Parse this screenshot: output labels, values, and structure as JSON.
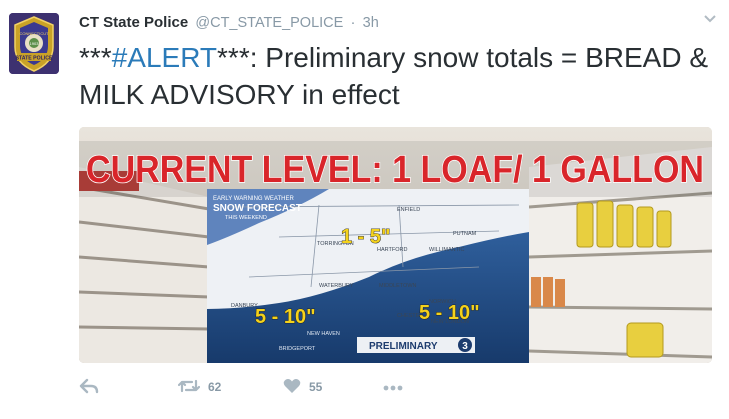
{
  "colors": {
    "accent": "#2b7bb9",
    "meta": "#8899a6",
    "text": "#292f33",
    "icon": "#aab8c2"
  },
  "tweet": {
    "avatar": {
      "icon": "ct-state-police-badge",
      "badge_text_top": "CONNECTICUT",
      "badge_year": "1903",
      "badge_text_bottom": "STATE POLICE"
    },
    "author_name": "CT State Police",
    "handle": "@CT_STATE_POLICE",
    "separator": "·",
    "timestamp": "3h",
    "text_prefix": "***",
    "hashtag": "#ALERT",
    "text_rest": "***: Preliminary snow totals = BREAD & MILK ADVISORY in effect",
    "media": {
      "banner": "CURRENT LEVEL: 1 LOAF/ 1 GALLON",
      "inset_header": "EARLY WARNING WEATHER",
      "inset_title": "SNOW FORECAST",
      "inset_subtitle": "THIS WEEKEND",
      "amount_north": "1 - 5\"",
      "amount_southwest": "5 - 10\"",
      "amount_southeast": "5 - 10\"",
      "preliminary_label": "PRELIMINARY",
      "channel": "3",
      "towns": [
        "ENFIELD",
        "PUTNAM",
        "TORRINGTON",
        "HARTFORD",
        "WILLIMANTIC",
        "DANBURY",
        "WATERBURY",
        "MIDDLETOWN",
        "NORWICH",
        "CHESTER",
        "NEW LONDON",
        "NEW HAVEN",
        "BRIDGEPORT"
      ]
    },
    "actions": {
      "reply_icon": "reply-icon",
      "retweet_icon": "retweet-icon",
      "retweet_count": "62",
      "like_icon": "heart-icon",
      "like_count": "55",
      "more_icon": "more-icon"
    }
  }
}
